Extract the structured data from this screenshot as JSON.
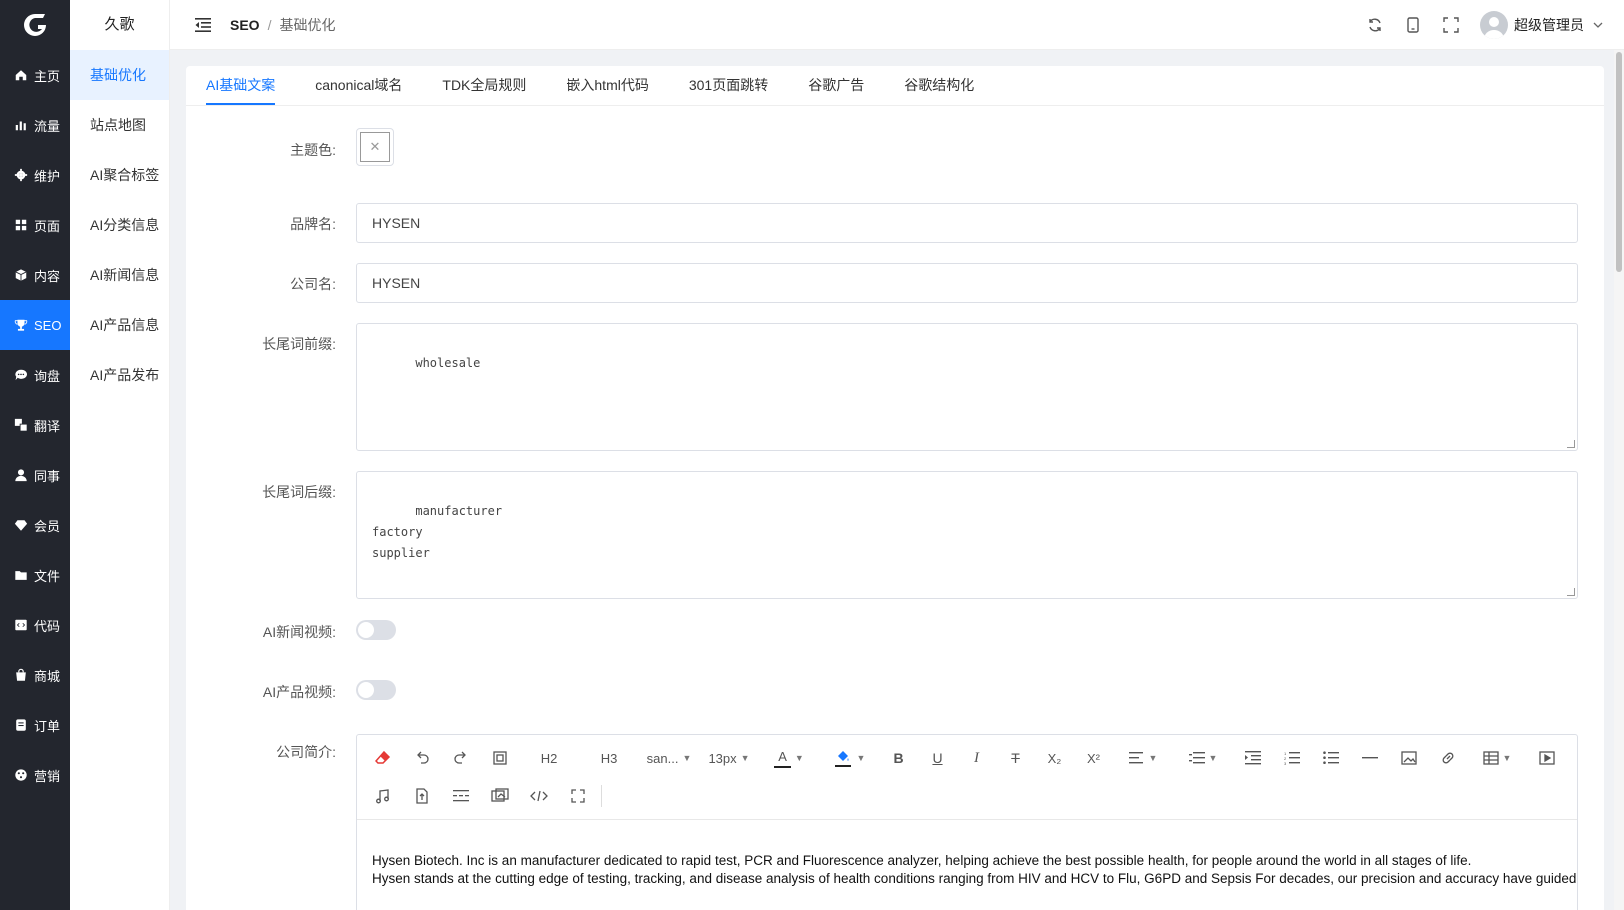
{
  "nav": {
    "items": [
      {
        "label": "主页",
        "icon": "home-icon"
      },
      {
        "label": "流量",
        "icon": "bar-chart-icon"
      },
      {
        "label": "维护",
        "icon": "gear-icon"
      },
      {
        "label": "页面",
        "icon": "grid-icon"
      },
      {
        "label": "内容",
        "icon": "box-icon"
      },
      {
        "label": "SEO",
        "icon": "trophy-icon",
        "active": true
      },
      {
        "label": "询盘",
        "icon": "chat-icon"
      },
      {
        "label": "翻译",
        "icon": "translate-icon"
      },
      {
        "label": "同事",
        "icon": "user-icon"
      },
      {
        "label": "会员",
        "icon": "diamond-icon"
      },
      {
        "label": "文件",
        "icon": "folder-icon"
      },
      {
        "label": "代码",
        "icon": "code-icon"
      },
      {
        "label": "商城",
        "icon": "shop-bag-icon"
      },
      {
        "label": "订单",
        "icon": "order-icon"
      },
      {
        "label": "营销",
        "icon": "marketing-icon"
      }
    ]
  },
  "subnav": {
    "title": "久歌",
    "items": [
      {
        "label": "基础优化",
        "active": true
      },
      {
        "label": "站点地图"
      },
      {
        "label": "AI聚合标签"
      },
      {
        "label": "AI分类信息"
      },
      {
        "label": "AI新闻信息"
      },
      {
        "label": "AI产品信息"
      },
      {
        "label": "AI产品发布"
      }
    ]
  },
  "header": {
    "breadcrumb": [
      "SEO",
      "基础优化"
    ],
    "user_name": "超级管理员"
  },
  "tabs": [
    {
      "label": "AI基础文案",
      "active": true
    },
    {
      "label": "canonical域名"
    },
    {
      "label": "TDK全局规则"
    },
    {
      "label": "嵌入html代码"
    },
    {
      "label": "301页面跳转"
    },
    {
      "label": "谷歌广告"
    },
    {
      "label": "谷歌结构化"
    }
  ],
  "form": {
    "theme_color_label": "主题色:",
    "brand_label": "品牌名:",
    "brand_value": "HYSEN",
    "company_label": "公司名:",
    "company_value": "HYSEN",
    "prefix_label": "长尾词前缀:",
    "prefix_value": "wholesale",
    "suffix_label": "长尾词后缀:",
    "suffix_value": "manufacturer\nfactory\nsupplier",
    "news_video_label": "AI新闻视频:",
    "news_video_on": false,
    "product_video_label": "AI产品视频:",
    "product_video_on": false,
    "intro_label": "公司简介:"
  },
  "editor": {
    "toolbar": {
      "h2": "H2",
      "h3": "H3",
      "font_family": "san...",
      "font_size": "13px",
      "text_color_glyph": "A"
    },
    "content": [
      "Hysen Biotech. Inc is an manufacturer dedicated to rapid test, PCR and Fluorescence analyzer, helping achieve the best possible health, for people around the world in all stages of life.",
      "Hysen stands at the cutting edge of testing, tracking, and disease analysis of health conditions ranging from HIV and HCV to Flu, G6PD and Sepsis For decades, our precision and accuracy have guided"
    ]
  },
  "colors": {
    "nav_bg": "#23262e",
    "accent": "#1677ff"
  }
}
